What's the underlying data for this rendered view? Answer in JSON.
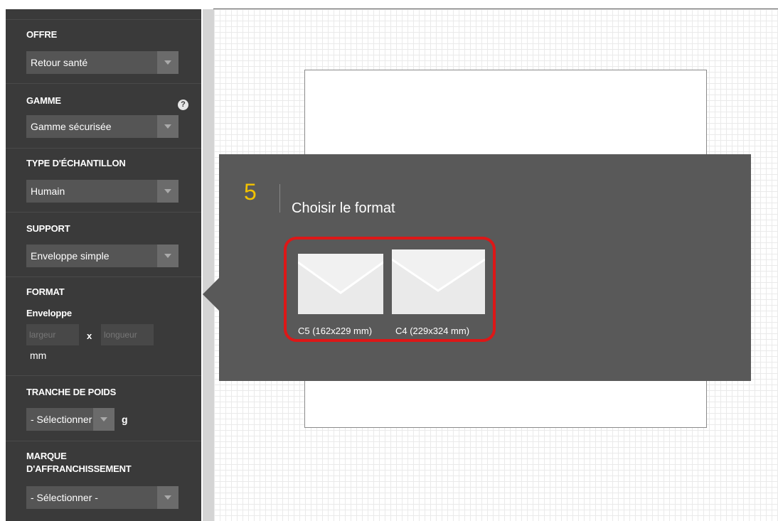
{
  "sidebar": {
    "offre": {
      "title": "OFFRE",
      "value": "Retour santé"
    },
    "gamme": {
      "title": "GAMME",
      "value": "Gamme sécurisée",
      "help": "?"
    },
    "type_echantillon": {
      "title": "TYPE D'ÉCHANTILLON",
      "value": "Humain"
    },
    "support": {
      "title": "SUPPORT",
      "value": "Enveloppe simple"
    },
    "format": {
      "title": "FORMAT",
      "subtitle": "Enveloppe",
      "width_placeholder": "largeur",
      "separator": "x",
      "length_placeholder": "longueur",
      "unit": "mm"
    },
    "tranche_poids": {
      "title": "TRANCHE DE POIDS",
      "value": "- Sélectionner -",
      "unit": "g"
    },
    "marque": {
      "title_line1": "MARQUE",
      "title_line2": "D'AFFRANCHISSEMENT",
      "value": "- Sélectionner -"
    }
  },
  "panel": {
    "step_number": "5",
    "step_title": "Choisir le format",
    "options": [
      {
        "label": "C5 (162x229 mm)",
        "icon": "envelope-icon"
      },
      {
        "label": "C4 (229x324 mm)",
        "icon": "envelope-icon"
      }
    ]
  },
  "colors": {
    "sidebar_bg": "#3a3a3a",
    "panel_bg": "#595959",
    "step_accent": "#f2c200",
    "highlight_border": "#dd1717"
  }
}
